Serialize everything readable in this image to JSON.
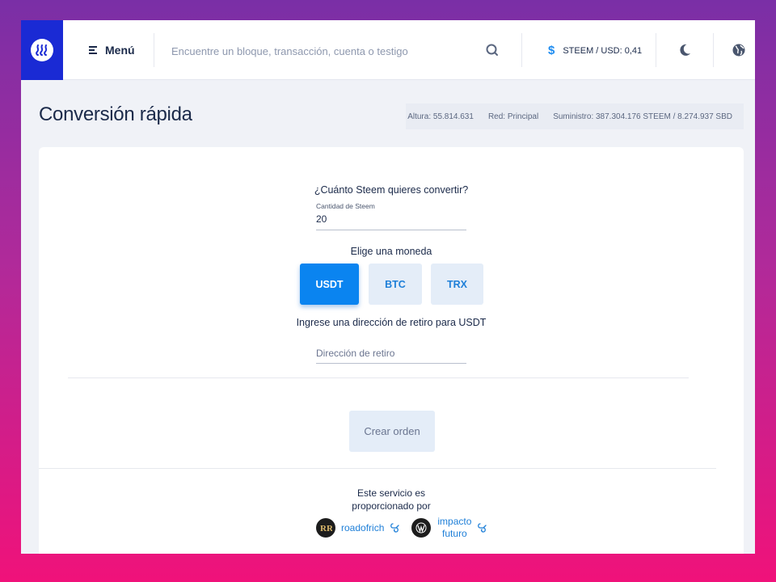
{
  "header": {
    "menu_label": "Menú",
    "search_placeholder": "Encuentre un bloque, transacción, cuenta o testigo",
    "price_symbol": "$",
    "price_text": "STEEM / USD: 0,41"
  },
  "page": {
    "title": "Conversión rápida",
    "stats": {
      "height": "Altura: 55.814.631",
      "network": "Red: Principal",
      "supply": "Suministro: 387.304.176 STEEM / 8.274.937 SBD"
    }
  },
  "form": {
    "question": "¿Cuánto Steem quieres convertir?",
    "amount_label": "Cantidad de Steem",
    "amount_value": "20",
    "choose_label": "Elige una moneda",
    "coins": [
      "USDT",
      "BTC",
      "TRX"
    ],
    "selected_coin": "USDT",
    "withdraw_label": "Ingrese una dirección de retiro para USDT",
    "withdraw_placeholder": "Dirección de retiro",
    "create_label": "Crear orden"
  },
  "footer": {
    "line1": "Este servicio es",
    "line2": "proporcionado por",
    "providers": [
      {
        "name": "roadofrich",
        "icon": "external-link-icon"
      },
      {
        "name_line1": "impacto",
        "name_line2": "futuro",
        "icon": "external-link-icon"
      }
    ]
  },
  "colors": {
    "brand": "#1a2ad4",
    "accent": "#0a84f0",
    "link": "#1e7fd8"
  }
}
